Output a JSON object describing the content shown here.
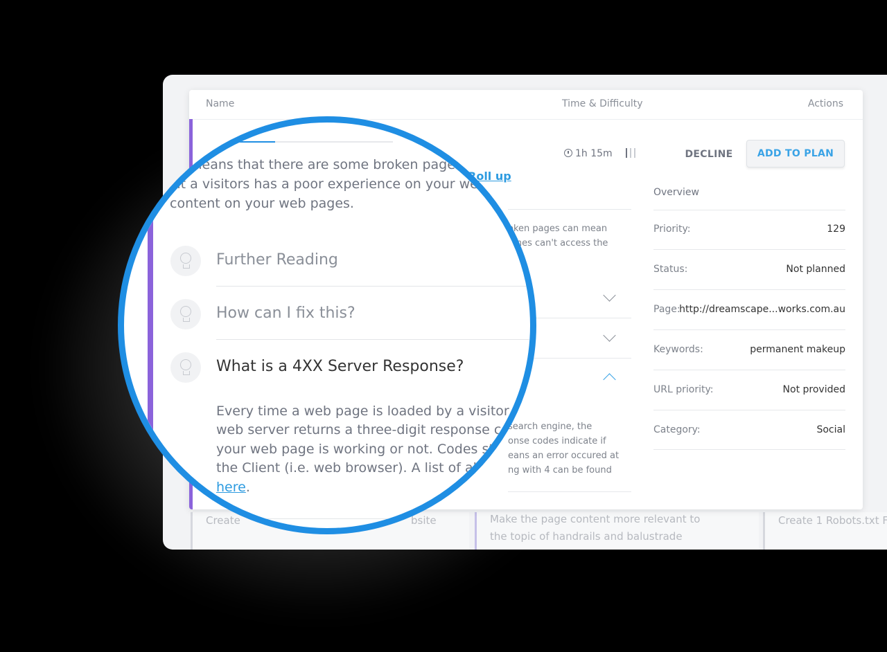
{
  "table": {
    "headers": {
      "name": "Name",
      "time_difficulty": "Time & Difficulty",
      "actions": "Actions"
    }
  },
  "task": {
    "time": "1h 15m",
    "rollup_label": "Roll up",
    "description_lines": [
      "means that there are some broken pages",
      "at a visitors has a poor experience on your web",
      "content on your web pages."
    ],
    "under_snippets": [
      "oken pages can mean",
      "gines can't access the"
    ],
    "answer_snippets": [
      "search engine, the",
      "onse codes indicate if",
      "eans an error occured at",
      "ng with 4 can be found"
    ]
  },
  "actions": {
    "decline": "DECLINE",
    "add_to_plan": "ADD TO PLAN"
  },
  "overview": {
    "title": "Overview",
    "rows": [
      {
        "label": "Priority:",
        "value": "129"
      },
      {
        "label": "Status:",
        "value": "Not planned"
      },
      {
        "label": "Page:",
        "value": "http://dreamscape...works.com.au"
      },
      {
        "label": "Keywords:",
        "value": "permanent makeup"
      },
      {
        "label": "URL priority:",
        "value": "Not provided"
      },
      {
        "label": "Category:",
        "value": "Social"
      }
    ]
  },
  "accordion": {
    "items": [
      {
        "title": "Further Reading"
      },
      {
        "title": "How can I fix this?"
      },
      {
        "title": "What is a 4XX Server Response?"
      }
    ],
    "answer_lines": [
      "Every time a web page is loaded by a visitor or",
      "web server returns a three-digit response cod",
      "your web page is working or not. Codes sta",
      "the Client (i.e. web browser). A list of all r"
    ],
    "answer_link": "here",
    "answer_end": "."
  },
  "bottom_cards": {
    "card1": "Create",
    "card1_tail": "bsite",
    "card2_lines": [
      "Make the page content more relevant to",
      "the topic of handrails and balustrade"
    ],
    "card3": "Create 1 Robots.txt F"
  },
  "colors": {
    "accent_purple": "#8b63db",
    "accent_blue": "#1f8ee3",
    "link_blue": "#2d9be0"
  }
}
